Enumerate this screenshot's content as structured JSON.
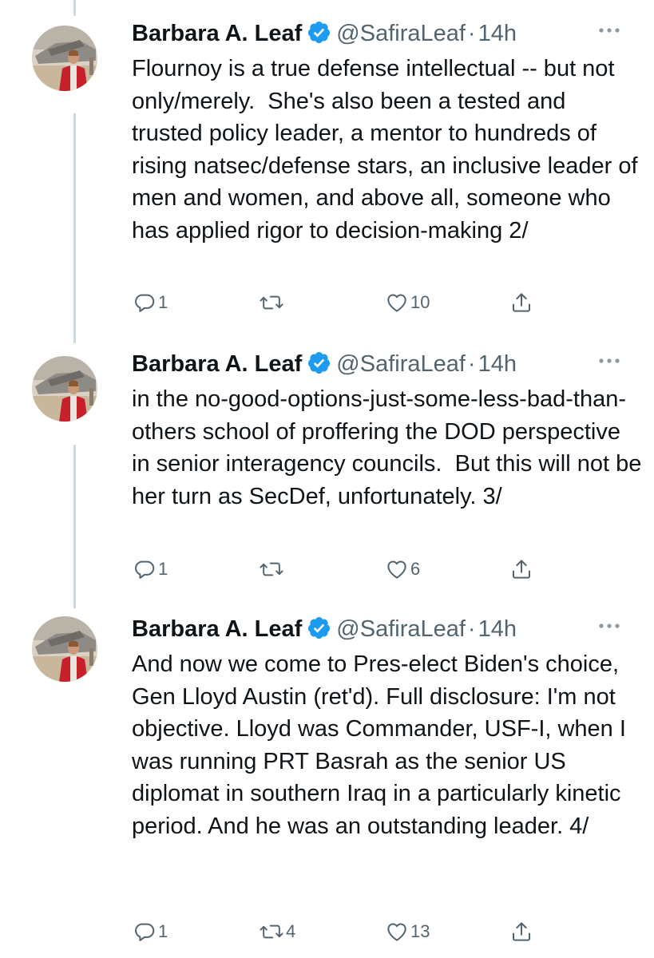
{
  "colors": {
    "verified": "#1d9bf0",
    "secondary_text": "#536471",
    "thread_line": "#cfd9de"
  },
  "tweets": [
    {
      "name": "Barbara A. Leaf",
      "handle": "@SafiraLeaf",
      "separator": "·",
      "time": "14h",
      "text": "Flournoy is a true defense intellectual -- but not only/merely.  She's also been a tested and trusted policy leader, a mentor to hundreds of rising natsec/defense stars, an inclusive leader of men and women, and above all, someone who has applied rigor to decision-making 2/",
      "replies": "1",
      "retweets": "",
      "likes": "10"
    },
    {
      "name": "Barbara A. Leaf",
      "handle": "@SafiraLeaf",
      "separator": "·",
      "time": "14h",
      "text": "in the no-good-options-just-some-less-bad-than-others school of proffering the DOD perspective in senior interagency councils.  But this will not be her turn as SecDef, unfortunately. 3/",
      "replies": "1",
      "retweets": "",
      "likes": "6"
    },
    {
      "name": "Barbara A. Leaf",
      "handle": "@SafiraLeaf",
      "separator": "·",
      "time": "14h",
      "text": "And now we come to Pres-elect Biden's choice, Gen Lloyd Austin (ret'd). Full disclosure: I'm not objective. Lloyd was Commander, USF-I, when I was running PRT Basrah as the senior US diplomat in southern Iraq in a particularly kinetic period. And he was an outstanding leader. 4/",
      "replies": "1",
      "retweets": "4",
      "likes": "13"
    }
  ]
}
